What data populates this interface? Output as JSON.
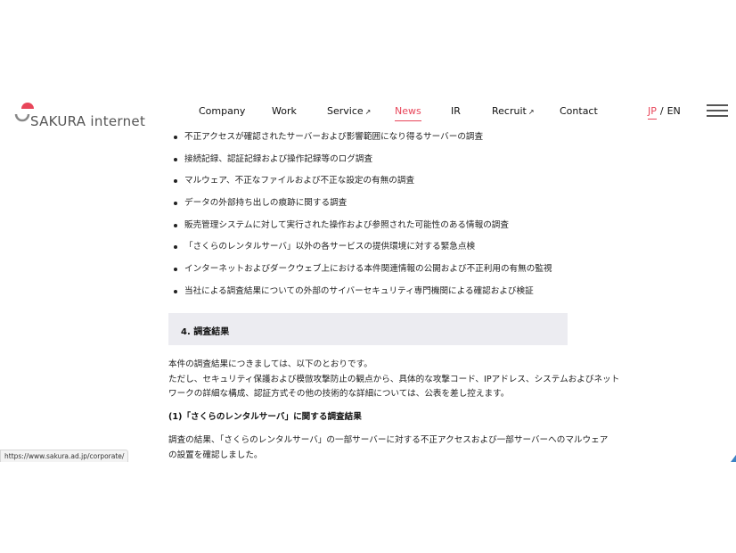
{
  "brand": {
    "logo_text": "SAKURA internet",
    "accent": "#e8465a"
  },
  "nav": {
    "company": "Company",
    "work": "Work",
    "service": "Service",
    "news": "News",
    "ir": "IR",
    "recruit": "Recruit",
    "contact": "Contact",
    "external_mark": "↗"
  },
  "lang": {
    "jp": "JP",
    "sep": "/",
    "en": "EN"
  },
  "bullets": [
    "不正アクセスが確認されたサーバーおよび影響範囲になり得るサーバーの調査",
    "接続記録、認証記録および操作記録等のログ調査",
    "マルウェア、不正なファイルおよび不正な設定の有無の調査",
    "データの外部持ち出しの痕跡に関する調査",
    "販売管理システムに対して実行された操作および参照された可能性のある情報の調査",
    "「さくらのレンタルサーバ」以外の各サービスの提供環境に対する緊急点検",
    "インターネットおよびダークウェブ上における本件関連情報の公開および不正利用の有無の監視",
    "当社による調査結果についての外部のサイバーセキュリティ専門機関による確認および検証"
  ],
  "section": {
    "title": "4. 調査結果"
  },
  "paragraph": [
    "本件の調査結果につきましては、以下のとおりです。",
    "ただし、セキュリティ保護および模倣攻撃防止の観点から、具体的な攻撃コード、IPアドレス、システムおよびネット",
    "ワークの詳細な構成、認証方式その他の技術的な詳細については、公表を差し控えます。"
  ],
  "subheading": "(1)「さくらのレンタルサーバ」に関する調査結果",
  "paragraph2": [
    "調査の結果、「さくらのレンタルサーバ」の一部サーバーに対する不正アクセスおよび一部サーバーへのマルウェア",
    "の設置を確認しました。"
  ],
  "status_bar": {
    "url": "https://www.sakura.ad.jp/corporate/"
  }
}
